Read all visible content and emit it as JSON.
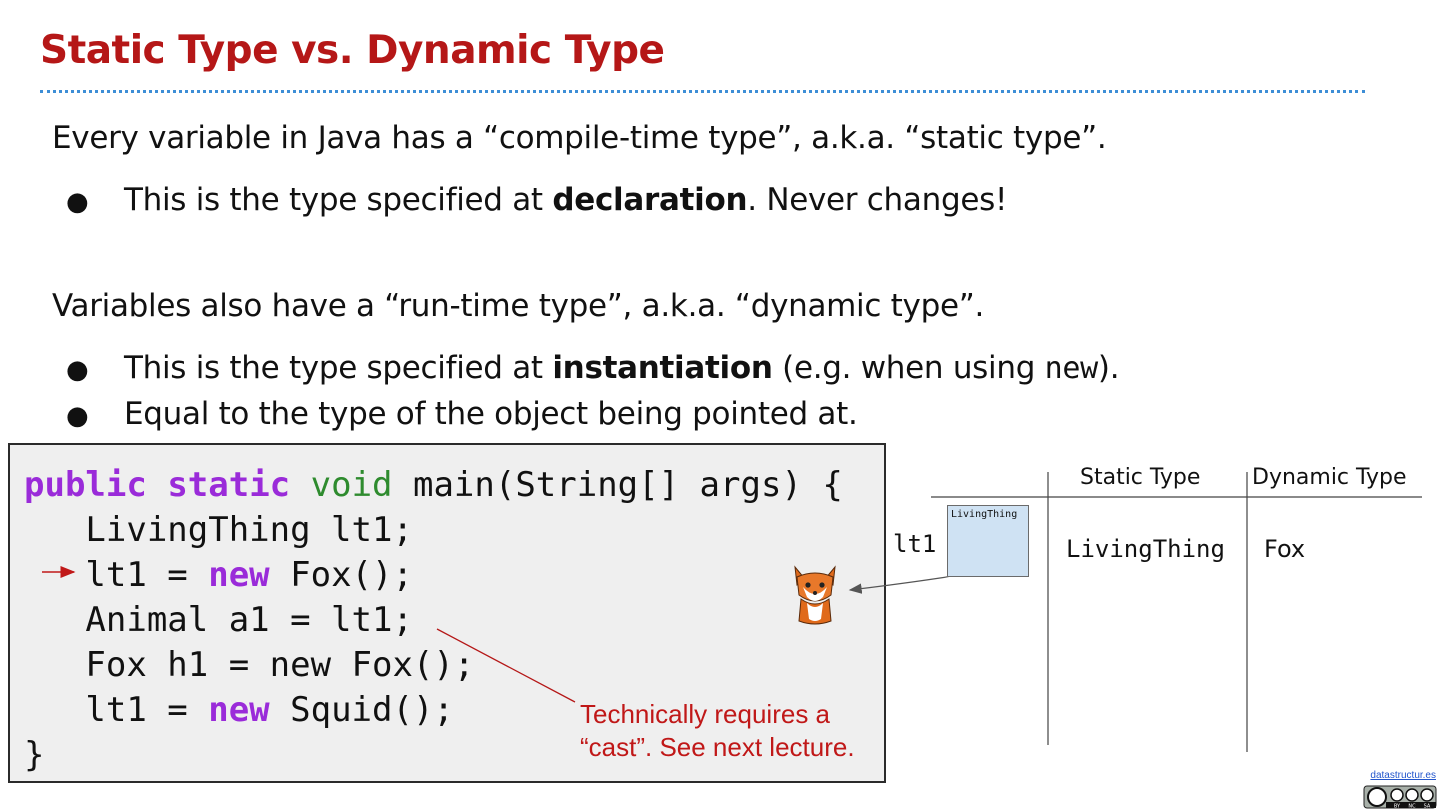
{
  "slide": {
    "title": "Static Type vs. Dynamic Type",
    "para1": "Every variable in Java has a “compile-time type”, a.k.a. “static type”.",
    "bullet1": {
      "pre": "This is the type specified at ",
      "bold": "declaration",
      "post": ". Never changes!"
    },
    "para2": "Variables also have a “run-time type”, a.k.a. “dynamic type”.",
    "bullet2": {
      "pre": "This is the type specified at ",
      "bold": "instantiation",
      "mid": " (e.g. when using ",
      "code": "new",
      "post": ")."
    },
    "bullet3": "Equal to the type of the object being pointed at.",
    "bullet_glyph": "●"
  },
  "code": {
    "line1": {
      "kw1": "public",
      "sp1": " ",
      "kw2": "static",
      "sp2": " ",
      "kw3": "void",
      "rest": " main(String[] args) {"
    },
    "line2": "   LivingThing lt1;",
    "line3": {
      "pre": "   lt1 = ",
      "kw": "new",
      "post": " Fox();"
    },
    "line4": "   Animal a1 = lt1;",
    "line5": "   Fox h1 = new Fox();",
    "line6": {
      "pre": "   lt1 = ",
      "kw": "new",
      "post": " Squid();"
    },
    "line7": "}",
    "note_line1": "Technically requires a",
    "note_line2": "“cast”. See next lecture."
  },
  "table": {
    "header_static": "Static Type",
    "header_dynamic": "Dynamic Type",
    "var_name": "lt1",
    "box_label": "LivingThing",
    "static_value": "LivingThing",
    "dynamic_value": "Fox"
  },
  "footer": {
    "link": "datastructur.es",
    "license_labels": [
      "BY",
      "NC",
      "SA"
    ]
  },
  "colors": {
    "title": "#b51717",
    "rule": "#3d8ed6",
    "keyword_purple": "#9a2bd9",
    "keyword_green": "#2e8b2e",
    "note_red": "#c01818",
    "box_fill": "#cfe2f3"
  }
}
